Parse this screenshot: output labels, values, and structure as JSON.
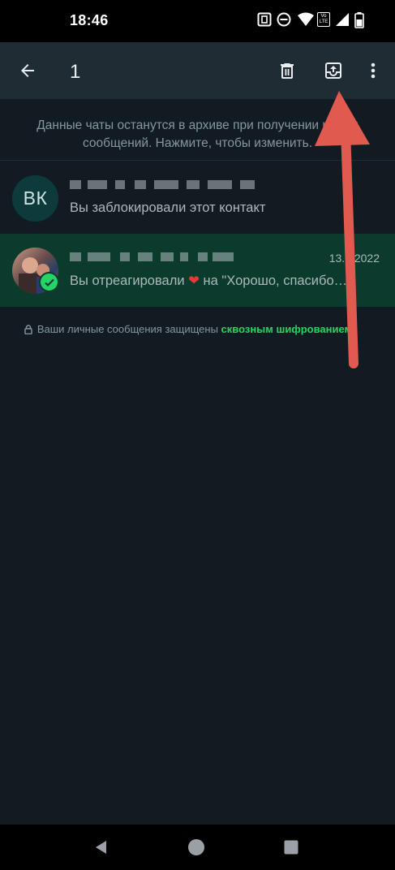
{
  "status_bar": {
    "time": "18:46",
    "icons": [
      "nfc-icon",
      "do-not-disturb-icon",
      "wifi-icon",
      "volte-icon",
      "signal-icon",
      "battery-icon"
    ],
    "volte_label": "Vo LTE"
  },
  "app_bar": {
    "selected_count": "1",
    "actions": [
      "back-icon",
      "delete-icon",
      "unarchive-icon",
      "more-options-icon"
    ]
  },
  "archive_note": "Данные чаты останутся в архиве при получении новых сообщений. Нажмите, чтобы изменить.",
  "chats": [
    {
      "avatar_initials": "ВК",
      "preview": "Вы заблокировали этот контакт",
      "date": "",
      "selected": false
    },
    {
      "avatar_initials": "",
      "preview_prefix": "Вы отреагировали ",
      "preview_emoji": "❤",
      "preview_suffix": " на \"Хорошо, спасибо…",
      "date": "13.1 2022",
      "selected": true
    }
  ],
  "e2e": {
    "text": "Ваши личные сообщения защищены ",
    "link": "сквозным шифрованием"
  },
  "colors": {
    "background": "#111b21",
    "app_bar": "#1f2c34",
    "selected_row": "#0b3b2d",
    "accent": "#25d366",
    "annotation_arrow": "#e05a4f"
  }
}
